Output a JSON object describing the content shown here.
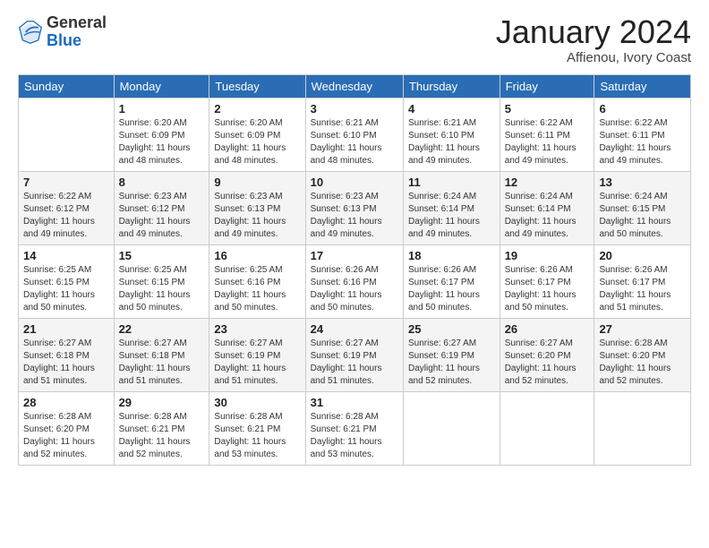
{
  "header": {
    "logo": {
      "line1": "General",
      "line2": "Blue"
    },
    "month": "January 2024",
    "location": "Affienou, Ivory Coast"
  },
  "days_of_week": [
    "Sunday",
    "Monday",
    "Tuesday",
    "Wednesday",
    "Thursday",
    "Friday",
    "Saturday"
  ],
  "weeks": [
    [
      {
        "num": "",
        "sunrise": "",
        "sunset": "",
        "daylight": ""
      },
      {
        "num": "1",
        "sunrise": "Sunrise: 6:20 AM",
        "sunset": "Sunset: 6:09 PM",
        "daylight": "Daylight: 11 hours and 48 minutes."
      },
      {
        "num": "2",
        "sunrise": "Sunrise: 6:20 AM",
        "sunset": "Sunset: 6:09 PM",
        "daylight": "Daylight: 11 hours and 48 minutes."
      },
      {
        "num": "3",
        "sunrise": "Sunrise: 6:21 AM",
        "sunset": "Sunset: 6:10 PM",
        "daylight": "Daylight: 11 hours and 48 minutes."
      },
      {
        "num": "4",
        "sunrise": "Sunrise: 6:21 AM",
        "sunset": "Sunset: 6:10 PM",
        "daylight": "Daylight: 11 hours and 49 minutes."
      },
      {
        "num": "5",
        "sunrise": "Sunrise: 6:22 AM",
        "sunset": "Sunset: 6:11 PM",
        "daylight": "Daylight: 11 hours and 49 minutes."
      },
      {
        "num": "6",
        "sunrise": "Sunrise: 6:22 AM",
        "sunset": "Sunset: 6:11 PM",
        "daylight": "Daylight: 11 hours and 49 minutes."
      }
    ],
    [
      {
        "num": "7",
        "sunrise": "Sunrise: 6:22 AM",
        "sunset": "Sunset: 6:12 PM",
        "daylight": "Daylight: 11 hours and 49 minutes."
      },
      {
        "num": "8",
        "sunrise": "Sunrise: 6:23 AM",
        "sunset": "Sunset: 6:12 PM",
        "daylight": "Daylight: 11 hours and 49 minutes."
      },
      {
        "num": "9",
        "sunrise": "Sunrise: 6:23 AM",
        "sunset": "Sunset: 6:13 PM",
        "daylight": "Daylight: 11 hours and 49 minutes."
      },
      {
        "num": "10",
        "sunrise": "Sunrise: 6:23 AM",
        "sunset": "Sunset: 6:13 PM",
        "daylight": "Daylight: 11 hours and 49 minutes."
      },
      {
        "num": "11",
        "sunrise": "Sunrise: 6:24 AM",
        "sunset": "Sunset: 6:14 PM",
        "daylight": "Daylight: 11 hours and 49 minutes."
      },
      {
        "num": "12",
        "sunrise": "Sunrise: 6:24 AM",
        "sunset": "Sunset: 6:14 PM",
        "daylight": "Daylight: 11 hours and 49 minutes."
      },
      {
        "num": "13",
        "sunrise": "Sunrise: 6:24 AM",
        "sunset": "Sunset: 6:15 PM",
        "daylight": "Daylight: 11 hours and 50 minutes."
      }
    ],
    [
      {
        "num": "14",
        "sunrise": "Sunrise: 6:25 AM",
        "sunset": "Sunset: 6:15 PM",
        "daylight": "Daylight: 11 hours and 50 minutes."
      },
      {
        "num": "15",
        "sunrise": "Sunrise: 6:25 AM",
        "sunset": "Sunset: 6:15 PM",
        "daylight": "Daylight: 11 hours and 50 minutes."
      },
      {
        "num": "16",
        "sunrise": "Sunrise: 6:25 AM",
        "sunset": "Sunset: 6:16 PM",
        "daylight": "Daylight: 11 hours and 50 minutes."
      },
      {
        "num": "17",
        "sunrise": "Sunrise: 6:26 AM",
        "sunset": "Sunset: 6:16 PM",
        "daylight": "Daylight: 11 hours and 50 minutes."
      },
      {
        "num": "18",
        "sunrise": "Sunrise: 6:26 AM",
        "sunset": "Sunset: 6:17 PM",
        "daylight": "Daylight: 11 hours and 50 minutes."
      },
      {
        "num": "19",
        "sunrise": "Sunrise: 6:26 AM",
        "sunset": "Sunset: 6:17 PM",
        "daylight": "Daylight: 11 hours and 50 minutes."
      },
      {
        "num": "20",
        "sunrise": "Sunrise: 6:26 AM",
        "sunset": "Sunset: 6:17 PM",
        "daylight": "Daylight: 11 hours and 51 minutes."
      }
    ],
    [
      {
        "num": "21",
        "sunrise": "Sunrise: 6:27 AM",
        "sunset": "Sunset: 6:18 PM",
        "daylight": "Daylight: 11 hours and 51 minutes."
      },
      {
        "num": "22",
        "sunrise": "Sunrise: 6:27 AM",
        "sunset": "Sunset: 6:18 PM",
        "daylight": "Daylight: 11 hours and 51 minutes."
      },
      {
        "num": "23",
        "sunrise": "Sunrise: 6:27 AM",
        "sunset": "Sunset: 6:19 PM",
        "daylight": "Daylight: 11 hours and 51 minutes."
      },
      {
        "num": "24",
        "sunrise": "Sunrise: 6:27 AM",
        "sunset": "Sunset: 6:19 PM",
        "daylight": "Daylight: 11 hours and 51 minutes."
      },
      {
        "num": "25",
        "sunrise": "Sunrise: 6:27 AM",
        "sunset": "Sunset: 6:19 PM",
        "daylight": "Daylight: 11 hours and 52 minutes."
      },
      {
        "num": "26",
        "sunrise": "Sunrise: 6:27 AM",
        "sunset": "Sunset: 6:20 PM",
        "daylight": "Daylight: 11 hours and 52 minutes."
      },
      {
        "num": "27",
        "sunrise": "Sunrise: 6:28 AM",
        "sunset": "Sunset: 6:20 PM",
        "daylight": "Daylight: 11 hours and 52 minutes."
      }
    ],
    [
      {
        "num": "28",
        "sunrise": "Sunrise: 6:28 AM",
        "sunset": "Sunset: 6:20 PM",
        "daylight": "Daylight: 11 hours and 52 minutes."
      },
      {
        "num": "29",
        "sunrise": "Sunrise: 6:28 AM",
        "sunset": "Sunset: 6:21 PM",
        "daylight": "Daylight: 11 hours and 52 minutes."
      },
      {
        "num": "30",
        "sunrise": "Sunrise: 6:28 AM",
        "sunset": "Sunset: 6:21 PM",
        "daylight": "Daylight: 11 hours and 53 minutes."
      },
      {
        "num": "31",
        "sunrise": "Sunrise: 6:28 AM",
        "sunset": "Sunset: 6:21 PM",
        "daylight": "Daylight: 11 hours and 53 minutes."
      },
      {
        "num": "",
        "sunrise": "",
        "sunset": "",
        "daylight": ""
      },
      {
        "num": "",
        "sunrise": "",
        "sunset": "",
        "daylight": ""
      },
      {
        "num": "",
        "sunrise": "",
        "sunset": "",
        "daylight": ""
      }
    ]
  ]
}
